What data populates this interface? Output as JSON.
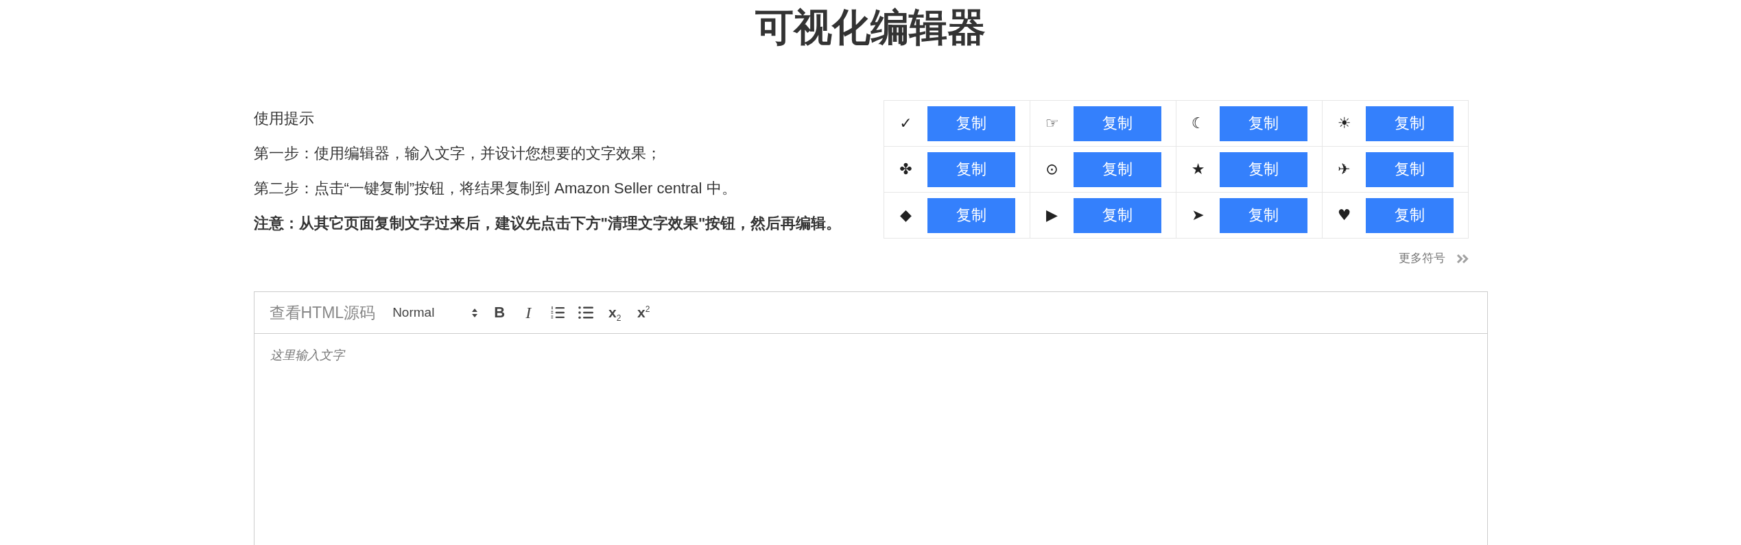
{
  "page": {
    "title": "可视化编辑器"
  },
  "instructions": {
    "lines": [
      {
        "kind": "heading",
        "text": "使用提示"
      },
      {
        "kind": "step",
        "text": "第一步：使用编辑器，输入文字，并设计您想要的文字效果；"
      },
      {
        "kind": "step",
        "text": "第二步：点击“一键复制”按钮，将结果复制到 Amazon Seller central 中。"
      },
      {
        "kind": "note",
        "text": "注意：从其它页面复制文字过来后，建议先点击下方\"清理文字效果\"按钮，然后再编辑。"
      }
    ]
  },
  "symbols": {
    "rows": [
      [
        {
          "symbol": "✓",
          "button": "复制"
        },
        {
          "symbol": "☞",
          "button": "复制"
        },
        {
          "symbol": "☾",
          "button": "复制"
        },
        {
          "symbol": "☀",
          "button": "复制"
        }
      ],
      [
        {
          "symbol": "✤",
          "button": "复制"
        },
        {
          "symbol": "⊙",
          "button": "复制"
        },
        {
          "symbol": "★",
          "button": "复制"
        },
        {
          "symbol": "✈",
          "button": "复制"
        }
      ],
      [
        {
          "symbol": "◆",
          "button": "复制"
        },
        {
          "symbol": "▶",
          "button": "复制"
        },
        {
          "symbol": "➤",
          "button": "复制"
        },
        {
          "symbol": "♥",
          "button": "复制"
        }
      ]
    ],
    "more_link": "更多符号"
  },
  "editor": {
    "toolbar": {
      "source_button": "查看HTML源码",
      "format_picker": "Normal",
      "buttons": [
        {
          "kind": "bold",
          "label": "B"
        },
        {
          "kind": "italic",
          "label": "I"
        },
        {
          "kind": "ordered-list"
        },
        {
          "kind": "bullet-list"
        },
        {
          "kind": "subscript",
          "label": "x$_{2}$"
        },
        {
          "kind": "superscript",
          "label": "x$^{2}$"
        }
      ]
    },
    "placeholder": "这里输入文字"
  }
}
